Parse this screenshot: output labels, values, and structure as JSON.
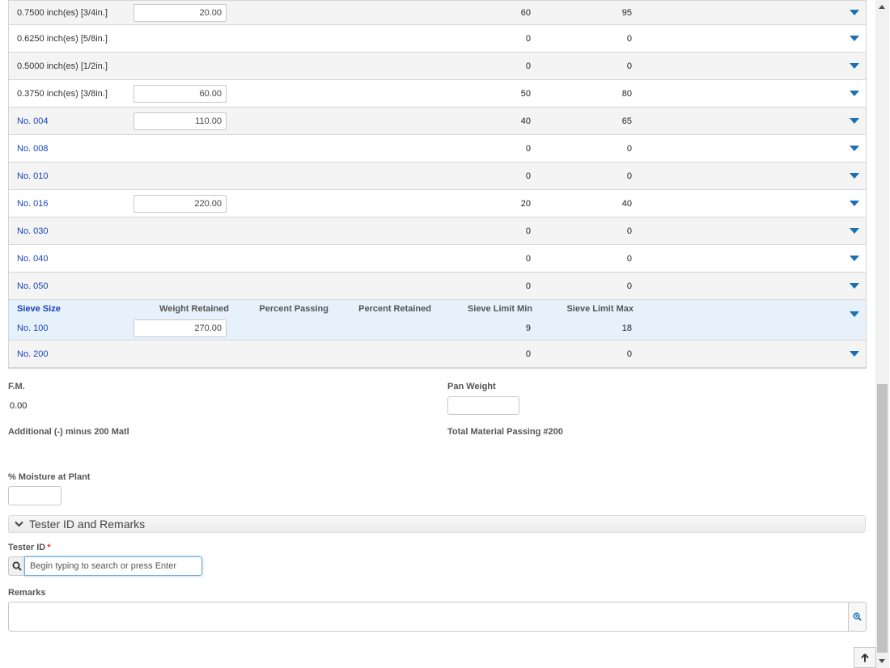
{
  "grid": {
    "headers": {
      "sieve_size": "Sieve Size",
      "weight_retained": "Weight Retained",
      "percent_passing": "Percent Passing",
      "percent_retained": "Percent Retained",
      "sieve_limit_min": "Sieve Limit Min",
      "sieve_limit_max": "Sieve Limit Max"
    },
    "rows": [
      {
        "sieve": "0.7500 inch(es) [3/4in.]",
        "weight": "20.00",
        "min": "60",
        "max": "95",
        "link": false
      },
      {
        "sieve": "0.6250 inch(es) [5/8in.]",
        "weight": "",
        "min": "0",
        "max": "0",
        "link": false
      },
      {
        "sieve": "0.5000 inch(es) [1/2in.]",
        "weight": "",
        "min": "0",
        "max": "0",
        "link": false
      },
      {
        "sieve": "0.3750 inch(es) [3/8in.]",
        "weight": "60.00",
        "min": "50",
        "max": "80",
        "link": false
      },
      {
        "sieve": "No. 004",
        "weight": "110.00",
        "min": "40",
        "max": "65",
        "link": true
      },
      {
        "sieve": "No. 008",
        "weight": "",
        "min": "0",
        "max": "0",
        "link": true
      },
      {
        "sieve": "No. 010",
        "weight": "",
        "min": "0",
        "max": "0",
        "link": true
      },
      {
        "sieve": "No. 016",
        "weight": "220.00",
        "min": "20",
        "max": "40",
        "link": true
      },
      {
        "sieve": "No. 030",
        "weight": "",
        "min": "0",
        "max": "0",
        "link": true
      },
      {
        "sieve": "No. 040",
        "weight": "",
        "min": "0",
        "max": "0",
        "link": true
      },
      {
        "sieve": "No. 050",
        "weight": "",
        "min": "0",
        "max": "0",
        "link": true
      },
      {
        "sieve": "No. 100",
        "weight": "270.00",
        "min": "9",
        "max": "18",
        "link": true,
        "selected": true
      },
      {
        "sieve": "No. 200",
        "weight": "",
        "min": "0",
        "max": "0",
        "link": true
      }
    ]
  },
  "fm": {
    "label": "F.M.",
    "value": "0.00"
  },
  "pan_weight": {
    "label": "Pan Weight",
    "value": ""
  },
  "additional_minus_200": {
    "label": "Additional (-) minus 200 Matl"
  },
  "total_passing_200": {
    "label": "Total Material Passing #200"
  },
  "moisture": {
    "label": "% Moisture at Plant",
    "value": ""
  },
  "tester_section": {
    "title": "Tester ID and Remarks",
    "tester_id_label": "Tester ID",
    "required_mark": "*",
    "search_placeholder": "Begin typing to search or press Enter",
    "remarks_label": "Remarks"
  },
  "colors": {
    "link": "#1a44b8",
    "caret": "#1b6fb5",
    "selected_row": "#e6f1fc",
    "required": "#d9342b"
  },
  "icons": {
    "row_expand": "caret-down-icon",
    "section_toggle": "chevron-down-icon",
    "search": "search-icon",
    "remarks_lookup": "zoom-in-icon",
    "back_to_top": "arrow-up-icon"
  }
}
